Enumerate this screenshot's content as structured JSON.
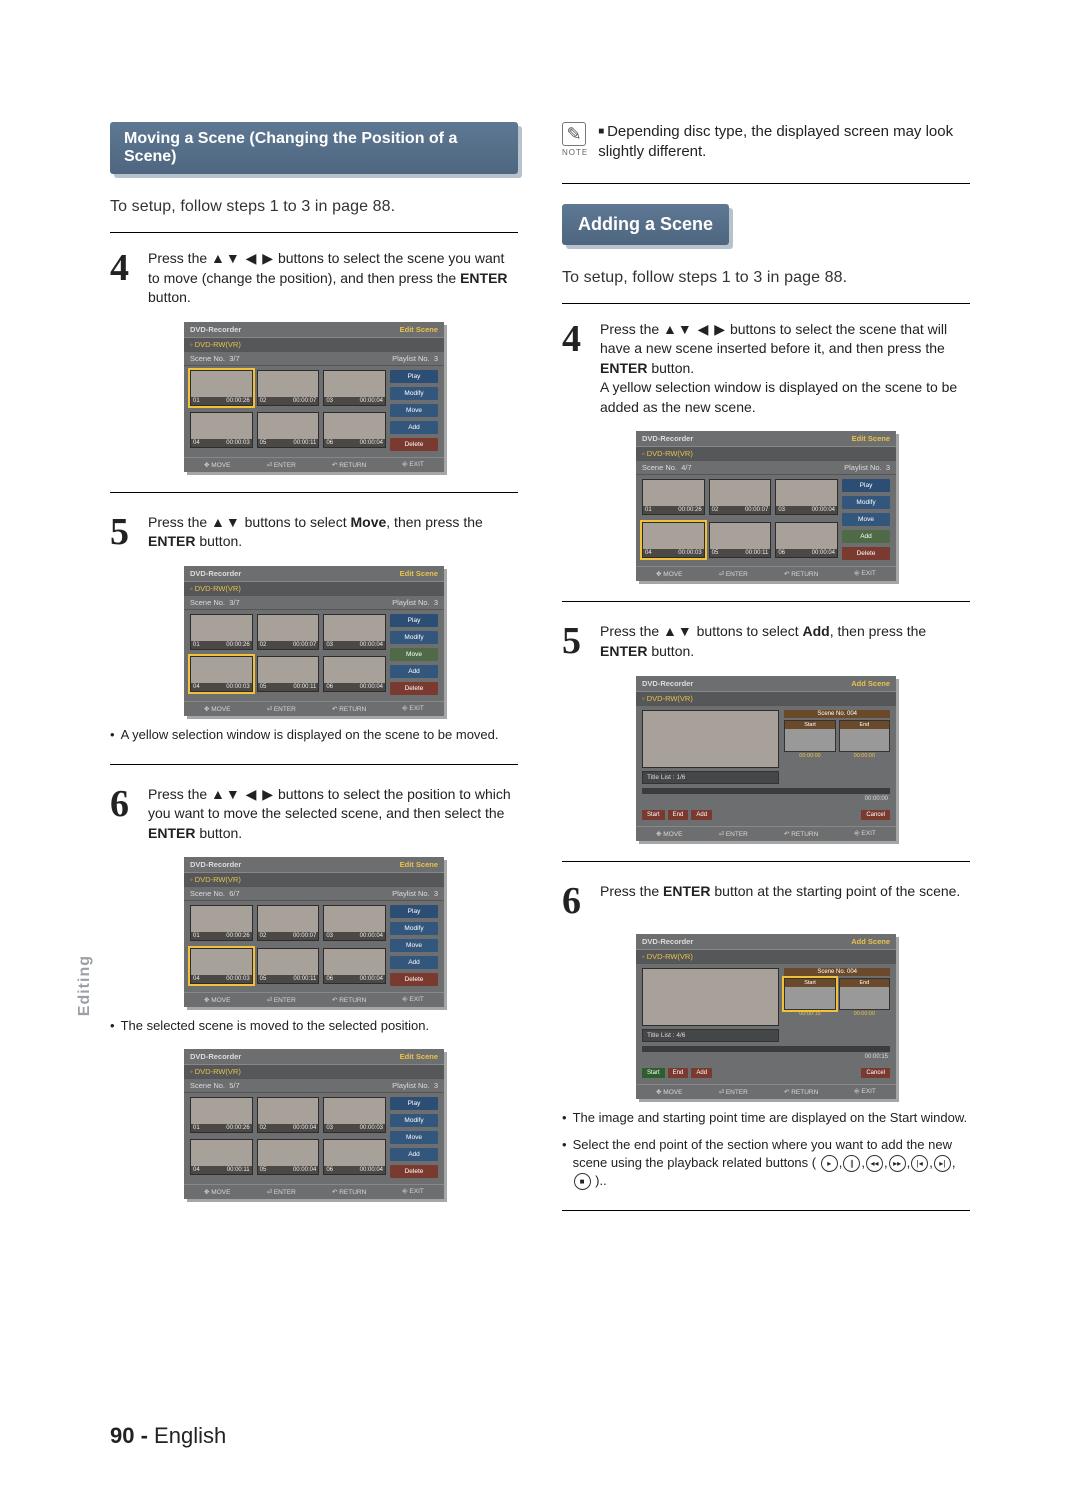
{
  "side_tab": "Editing",
  "page_footer": {
    "num": "90 -",
    "lang": "English"
  },
  "left": {
    "heading": "Moving a Scene (Changing the Position of a Scene)",
    "lead": "To setup, follow steps 1 to 3 in page 88.",
    "step4": {
      "num": "4",
      "pre": "Press the ",
      "arrows": "▲▼ ◀ ▶",
      "post": " buttons to select the scene you want to move (change the position), and then press the ",
      "btn": "ENTER",
      "tail": " button."
    },
    "step5": {
      "num": "5",
      "pre": "Press the ",
      "arrows": "▲▼",
      "mid": " buttons to select ",
      "target": "Move",
      "post": ", then press the ",
      "btn": "ENTER",
      "tail": " button."
    },
    "bullet5": "A yellow selection window is displayed on the scene to be moved.",
    "step6": {
      "num": "6",
      "pre": "Press the ",
      "arrows": "▲▼ ◀ ▶",
      "post": " buttons to select the position to which you want to move the selected scene, and then select the ",
      "btn": "ENTER",
      "tail": " button."
    },
    "bullet6": "The selected scene is moved to the selected position."
  },
  "right": {
    "note": "Depending disc type, the displayed screen may look slightly different.",
    "note_label": "NOTE",
    "heading": "Adding a Scene",
    "lead": "To setup, follow steps 1 to 3 in page 88.",
    "step4": {
      "num": "4",
      "pre": "Press the ",
      "arrows": "▲▼ ◀ ▶",
      "post": " buttons to select the scene that will have a new scene inserted before it, and then press the ",
      "btn": "ENTER",
      "tail": " button.",
      "extra": "A yellow selection window is displayed on the scene to be added as the new scene."
    },
    "step5": {
      "num": "5",
      "pre": "Press the ",
      "arrows": "▲▼",
      "mid": " buttons to select ",
      "target": "Add",
      "post": ", then press the ",
      "btn": "ENTER",
      "tail": " button."
    },
    "step6": {
      "num": "6",
      "pre": "Press the ",
      "btn": "ENTER",
      "post": " button at the starting point of the scene."
    },
    "bullets": [
      "The image and starting point time are displayed on the Start window.",
      "Select the end point of the section where you want to add the new scene using the playback related buttons ( "
    ],
    "bullets_tail": " )."
  },
  "screen_common": {
    "title_left": "DVD-Recorder",
    "mode_edit": "Edit Scene",
    "mode_add": "Add Scene",
    "disc": "DVD-RW(VR)",
    "scene": "Scene No.",
    "playlist": "Playlist No.",
    "pl_no": "3",
    "menu": {
      "play": "Play",
      "modify": "Modify",
      "move": "Move",
      "add": "Add",
      "delete": "Delete"
    },
    "foot": {
      "move": "MOVE",
      "enter": "ENTER",
      "return": "RETURN",
      "exit": "EXIT"
    },
    "foot_icons": {
      "move": "✥",
      "enter": "⏎",
      "return": "↶",
      "exit": "⎆"
    }
  },
  "screens_edit": [
    {
      "sceneno": "3/7",
      "highlight": 0,
      "menu_sel": "play",
      "thumbs": [
        [
          "01",
          "00:00:26"
        ],
        [
          "02",
          "00:00:07"
        ],
        [
          "03",
          "00:00:04"
        ],
        [
          "04",
          "00:00:03"
        ],
        [
          "05",
          "00:00:11"
        ],
        [
          "06",
          "00:00:04"
        ]
      ]
    },
    {
      "sceneno": "3/7",
      "highlight": 3,
      "menu_sel": "move",
      "thumbs": [
        [
          "01",
          "00:00:26"
        ],
        [
          "02",
          "00:00:07"
        ],
        [
          "03",
          "00:00:04"
        ],
        [
          "04",
          "00:00:03"
        ],
        [
          "05",
          "00:00:11"
        ],
        [
          "06",
          "00:00:04"
        ]
      ]
    },
    {
      "sceneno": "6/7",
      "highlight": 3,
      "menu_sel": "play",
      "thumbs": [
        [
          "01",
          "00:00:26"
        ],
        [
          "02",
          "00:00:07"
        ],
        [
          "03",
          "00:00:04"
        ],
        [
          "04",
          "00:00:03"
        ],
        [
          "05",
          "00:00:11"
        ],
        [
          "06",
          "00:00:04"
        ]
      ]
    },
    {
      "sceneno": "5/7",
      "highlight": null,
      "menu_sel": "play",
      "thumbs": [
        [
          "01",
          "00:00:26"
        ],
        [
          "02",
          "00:00:04"
        ],
        [
          "03",
          "00:00:03"
        ],
        [
          "04",
          "00:00:11"
        ],
        [
          "05",
          "00:00:04"
        ],
        [
          "06",
          "00:00:04"
        ]
      ]
    }
  ],
  "screen_edit_right": {
    "sceneno": "4/7",
    "highlight": 3,
    "menu_sel": "add",
    "thumbs": [
      [
        "01",
        "00:00:26"
      ],
      [
        "02",
        "00:00:07"
      ],
      [
        "03",
        "00:00:04"
      ],
      [
        "04",
        "00:00:03"
      ],
      [
        "05",
        "00:00:11"
      ],
      [
        "06",
        "00:00:04"
      ]
    ]
  },
  "screens_add": [
    {
      "sceneno_lbl": "Scene No. 004",
      "titlelist": "Title List : 1/6",
      "start_t": "00:00:00",
      "end_t": "00:00:00",
      "time": "00:00:00",
      "btns": [
        "Start",
        "End",
        "Add"
      ],
      "cancel": "Cancel",
      "sel": null,
      "start_hi": false
    },
    {
      "sceneno_lbl": "Scene No. 004",
      "titlelist": "Title List : 4/6",
      "start_t": "00:00:15",
      "end_t": "00:00:00",
      "time": "00:00:15",
      "btns": [
        "Start",
        "End",
        "Add"
      ],
      "cancel": "Cancel",
      "sel": 0,
      "start_hi": true
    }
  ],
  "addsc_labels": {
    "start": "Start",
    "end": "End"
  }
}
